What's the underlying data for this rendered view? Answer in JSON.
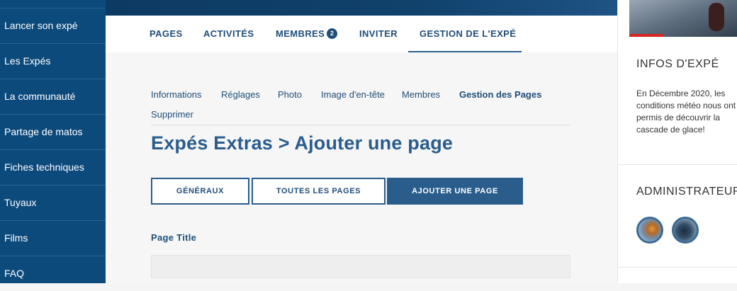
{
  "sidebar": {
    "items": [
      {
        "label": "Lancer son expé"
      },
      {
        "label": "Les Expés"
      },
      {
        "label": "La communauté"
      },
      {
        "label": "Partage de matos"
      },
      {
        "label": "Fiches techniques"
      },
      {
        "label": "Tuyaux"
      },
      {
        "label": "Films"
      },
      {
        "label": "FAQ"
      }
    ]
  },
  "tabs": {
    "pages": "PAGES",
    "activites": "ACTIVITÉS",
    "membres": "MEMBRES",
    "membres_count": "2",
    "inviter": "INVITER",
    "gestion": "GESTION DE L'EXPÉ"
  },
  "subnav": {
    "informations": "Informations",
    "reglages": "Réglages",
    "photo": "Photo",
    "image_entete": "Image d'en-tête",
    "membres": "Membres",
    "gestion_pages": "Gestion des Pages",
    "supprimer": "Supprimer"
  },
  "page": {
    "title": "Expés Extras > Ajouter une page"
  },
  "buttons": {
    "generaux": "GÉNÉRAUX",
    "toutes_pages": "TOUTES LES PAGES",
    "ajouter_page": "AJOUTER UNE PAGE"
  },
  "form": {
    "page_title_label": "Page Title",
    "page_title_value": ""
  },
  "right_panel": {
    "infos_heading": "INFOS D'EXPÉ",
    "infos_text": "En Décembre 2020, les conditions météo nous ont permis de découvrir la cascade de glace!",
    "admins_heading": "ADMINISTRATEURS"
  },
  "colors": {
    "sidebar_bg": "#0d4a7c",
    "accent": "#2a5d8c",
    "text_dark": "#1f4e79"
  }
}
